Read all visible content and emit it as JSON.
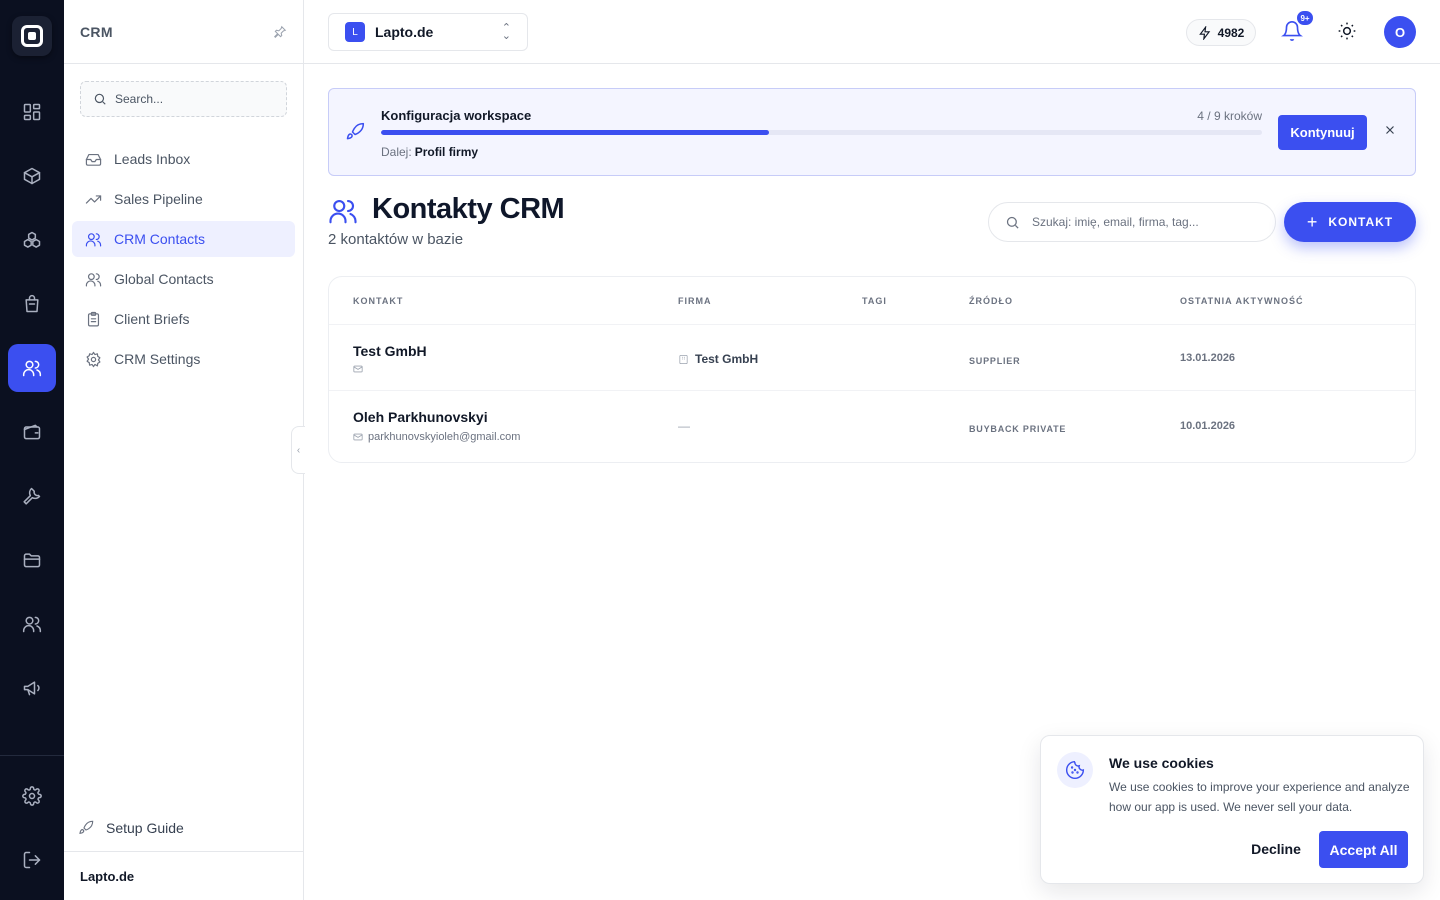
{
  "rail": {
    "items": [
      "dashboard-icon",
      "box-icon",
      "modules-icon",
      "shopping-bag-icon",
      "users-icon",
      "wallet-icon",
      "wrench-icon",
      "folder-icon",
      "team-icon",
      "megaphone-icon",
      "settings-icon",
      "logout-icon"
    ],
    "active": "users-icon"
  },
  "sidebar": {
    "title": "CRM",
    "search_placeholder": "Search...",
    "items": [
      {
        "label": "Leads Inbox",
        "icon": "inbox-icon"
      },
      {
        "label": "Sales Pipeline",
        "icon": "trending-up-icon"
      },
      {
        "label": "CRM Contacts",
        "icon": "users-icon",
        "active": true
      },
      {
        "label": "Global Contacts",
        "icon": "users-icon"
      },
      {
        "label": "Client Briefs",
        "icon": "clipboard-icon"
      },
      {
        "label": "CRM Settings",
        "icon": "gear-icon"
      }
    ],
    "setup_guide": "Setup Guide",
    "footer": "Lapto.de"
  },
  "topbar": {
    "workspace_initial": "L",
    "workspace_name": "Lapto.de",
    "credits": "4982",
    "notifications_badge": "9+",
    "avatar_initial": "O"
  },
  "banner": {
    "title": "Konfiguracja workspace",
    "steps": "4 / 9 kroków",
    "progress": 0.44,
    "next_label": "Dalej:",
    "next_value": "Profil firmy",
    "continue_label": "Kontynuuj"
  },
  "page": {
    "title": "Kontakty CRM",
    "subtitle": "2 kontaktów w bazie",
    "search_placeholder": "Szukaj: imię, email, firma, tag...",
    "add_label": "KONTAKT"
  },
  "table": {
    "headers": [
      "KONTAKT",
      "FIRMA",
      "TAGI",
      "ŹRÓDŁO",
      "OSTATNIA AKTYWNOŚĆ"
    ],
    "rows": [
      {
        "name": "Test GmbH",
        "email": "",
        "firm": "Test GmbH",
        "tags": "",
        "source": "SUPPLIER",
        "last_activity": "13.01.2026"
      },
      {
        "name": "Oleh Parkhunovskyi",
        "email": "parkhunovskyioleh@gmail.com",
        "firm": "—",
        "tags": "",
        "source": "BUYBACK PRIVATE",
        "last_activity": "10.01.2026"
      }
    ]
  },
  "cookie": {
    "title": "We use cookies",
    "text": "We use cookies to improve your experience and analyze how our app is used. We never sell your data.",
    "decline": "Decline",
    "accept": "Accept All"
  },
  "colors": {
    "accent": "#3b4ff0",
    "rail_bg": "#0b1020",
    "banner_bg": "#f4f5ff"
  }
}
